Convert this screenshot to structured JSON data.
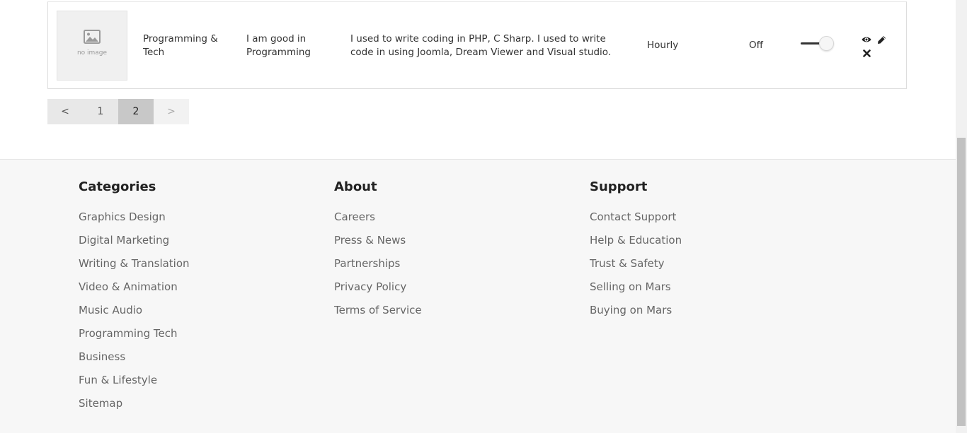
{
  "row": {
    "thumbnail_text": "no image",
    "category": "Programming & Tech",
    "title": "I am good in Programming",
    "description": "I used to write coding in PHP, C Sharp. I used to write code in using Joomla, Dream Viewer and Visual studio.",
    "pricing_type": "Hourly",
    "status": "Off",
    "actions": [
      "eye-icon",
      "pencil-icon",
      "close-icon"
    ]
  },
  "pagination": {
    "prev": "<",
    "pages": [
      "1",
      "2"
    ],
    "current": "2",
    "next": ">"
  },
  "footer": {
    "categories": {
      "heading": "Categories",
      "links": [
        "Graphics Design",
        "Digital Marketing",
        "Writing & Translation",
        "Video & Animation",
        "Music Audio",
        "Programming Tech",
        "Business",
        "Fun & Lifestyle",
        "Sitemap"
      ]
    },
    "about": {
      "heading": "About",
      "links": [
        "Careers",
        "Press & News",
        "Partnerships",
        "Privacy Policy",
        "Terms of Service"
      ]
    },
    "support": {
      "heading": "Support",
      "links": [
        "Contact Support",
        "Help & Education",
        "Trust & Safety",
        "Selling on Mars",
        "Buying on Mars"
      ]
    }
  }
}
